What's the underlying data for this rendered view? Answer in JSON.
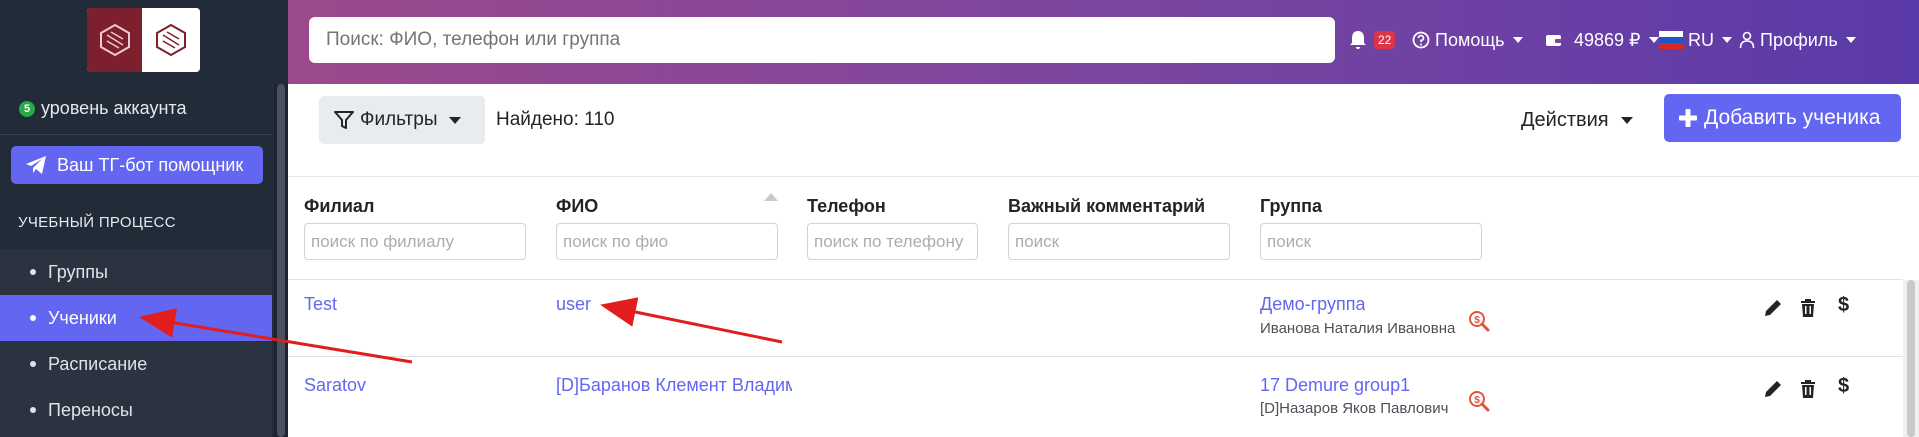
{
  "sidebar": {
    "level_badge": "5",
    "level_text": "уровень аккаунта",
    "tg_button": "Ваш ТГ-бот помощник",
    "section_title": "УЧЕБНЫЙ ПРОЦЕСС",
    "items": [
      {
        "label": "Группы"
      },
      {
        "label": "Ученики"
      },
      {
        "label": "Расписание"
      },
      {
        "label": "Переносы"
      }
    ]
  },
  "header": {
    "search_placeholder": "Поиск: ФИО, телефон или группа",
    "notifications_count": "22",
    "help": "Помощь",
    "balance": "49869 ₽",
    "language": "RU",
    "profile": "Профиль"
  },
  "toolbar": {
    "filters": "Фильтры",
    "found": "Найдено: 110",
    "actions": "Действия",
    "add_student": "Добавить ученика"
  },
  "table": {
    "columns": [
      "Филиал",
      "ФИО",
      "Телефон",
      "Важный комментарий",
      "Группа"
    ],
    "filter_placeholders": [
      "поиск по филиалу",
      "поиск по фио",
      "поиск по телефону",
      "поиск",
      "поиск"
    ],
    "rows": [
      {
        "branch": "Test",
        "name": "user",
        "phone": "",
        "comment": "",
        "group": "Демо-группа",
        "teacher": "Иванова Наталия Ивановна"
      },
      {
        "branch": "Saratov",
        "name": "[D]Баранов Клемент Владимирович",
        "phone": "",
        "comment": "",
        "group": "17 Demure group1",
        "teacher": "[D]Назаров Яков Павлович"
      }
    ]
  },
  "colors": {
    "accent": "#6366f1",
    "sidebar_bg": "#222b38",
    "annotation_arrow": "#e11d1d"
  }
}
